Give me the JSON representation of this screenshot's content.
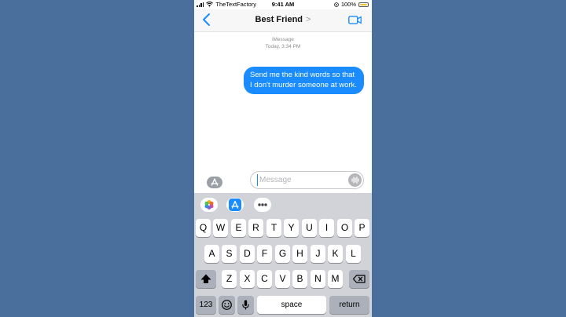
{
  "status_bar": {
    "carrier": "TheTextFactory",
    "time": "9:41 AM",
    "battery": "100%"
  },
  "nav": {
    "back_icon": "chevron-left-icon",
    "contact_name": "Best Friend",
    "contact_chevron": ">",
    "video_icon": "video-camera-icon"
  },
  "thread": {
    "service": "iMessage",
    "timestamp": "Today, 3:34 PM",
    "messages": [
      {
        "from": "me",
        "text": "Send me the kind words so that I don't murder someone at work."
      }
    ]
  },
  "composer": {
    "placeholder": "Message",
    "apps_icon": "app-store-icon",
    "voice_icon": "waveform-icon"
  },
  "app_tray": [
    {
      "icon": "photos-icon"
    },
    {
      "icon": "app-store-icon"
    },
    {
      "icon": "more-icon"
    }
  ],
  "keyboard": {
    "row1": [
      "Q",
      "W",
      "E",
      "R",
      "T",
      "Y",
      "U",
      "I",
      "O",
      "P"
    ],
    "row2": [
      "A",
      "S",
      "D",
      "F",
      "G",
      "H",
      "J",
      "K",
      "L"
    ],
    "row3": [
      "Z",
      "X",
      "C",
      "V",
      "B",
      "N",
      "M"
    ],
    "numbers_label": "123",
    "space_label": "space",
    "return_label": "return",
    "shift_icon": "shift-icon",
    "backspace_icon": "backspace-icon",
    "emoji_icon": "emoji-icon",
    "mic_icon": "microphone-icon"
  },
  "colors": {
    "bubble": "#1a8cff",
    "accent": "#1a8cff",
    "battery": "#f2c12e",
    "background": "#4a6f9c"
  }
}
